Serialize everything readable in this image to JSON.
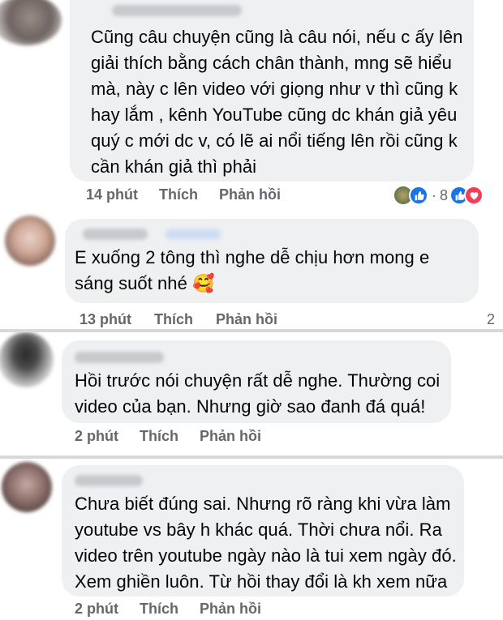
{
  "comments": [
    {
      "text_lines": [
        "Cũng câu chuyện cũng là câu nói, nếu c ấy lên",
        "giải thích bằng cách chân thành, mng sẽ hiểu",
        "mà, này c lên video với giọng như v thì cũng k",
        "hay lắm , kênh YouTube cũng dc khán giả yêu",
        "quý c mới dc v, có lẽ ai nổi tiếng lên rồi cũng k",
        "cần khán giả thì phải"
      ],
      "time": "14 phút",
      "like_label": "Thích",
      "reply_label": "Phản hồi",
      "reaction_separator": "·",
      "reaction_count": "8"
    },
    {
      "text_lines": [
        "E xuống 2 tông thì nghe dễ chịu hơn mong e",
        "sáng suốt nhé"
      ],
      "emoji": "🥰",
      "time": "13 phút",
      "like_label": "Thích",
      "reply_label": "Phản hồi",
      "reaction_count": "2"
    },
    {
      "text_lines": [
        "Hồi trước nói chuyện rất dễ nghe. Thường coi",
        "video của bạn. Nhưng giờ sao đanh đá quá!"
      ],
      "time": "2 phút",
      "like_label": "Thích",
      "reply_label": "Phản hồi"
    },
    {
      "text_lines": [
        "Chưa biết đúng sai. Nhưng rõ ràng khi vừa làm",
        "youtube vs bây h khác quá. Thời chưa nổi. Ra",
        "video trên youtube ngày nào là tui xem ngày đó.",
        "Xem ghiền luôn. Từ hồi thay đổi là kh xem nữa"
      ],
      "time": "2 phút",
      "like_label": "Thích",
      "reply_label": "Phản hồi"
    }
  ],
  "colors": {
    "bubble": "#eff0f2",
    "meta": "#65676b",
    "like_blue": "#1b74e4",
    "love_red": "#f33e58",
    "separator": "#d8d8d8"
  }
}
